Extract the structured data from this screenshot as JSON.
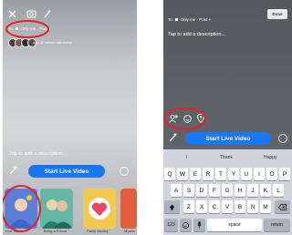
{
  "left_screen": {
    "audience_prefix": "To:",
    "audience_value": "Only me · Post",
    "friends_text": "and 32 others are online",
    "description_placeholder": "Tap to add a description...",
    "start_button": "Start Live Video",
    "tiles": [
      {
        "label": "Live Video"
      },
      {
        "label": "Bring a Friend"
      },
      {
        "label": "Raise Money"
      },
      {
        "label": "Myster"
      }
    ]
  },
  "right_screen": {
    "done_button": "Done",
    "audience_prefix": "To:",
    "audience_value": "Only me · Post",
    "description_placeholder": "Tap to add a description...",
    "start_button": "Start Live Video",
    "suggestions": [
      "I",
      "Thank",
      "Happy"
    ],
    "keyboard": {
      "row1": [
        "Q",
        "W",
        "E",
        "R",
        "T",
        "Y",
        "U",
        "I",
        "O",
        "P"
      ],
      "row2": [
        "A",
        "S",
        "D",
        "F",
        "G",
        "H",
        "J",
        "K",
        "L"
      ],
      "row3": [
        "Z",
        "X",
        "C",
        "V",
        "B",
        "N",
        "M"
      ],
      "numbers_key": "123",
      "space_key": "space",
      "return_key": "return"
    }
  },
  "colors": {
    "accent": "#1877f2",
    "highlight_ring": "#e3222b",
    "keyboard_bg": "#d1d4da"
  }
}
